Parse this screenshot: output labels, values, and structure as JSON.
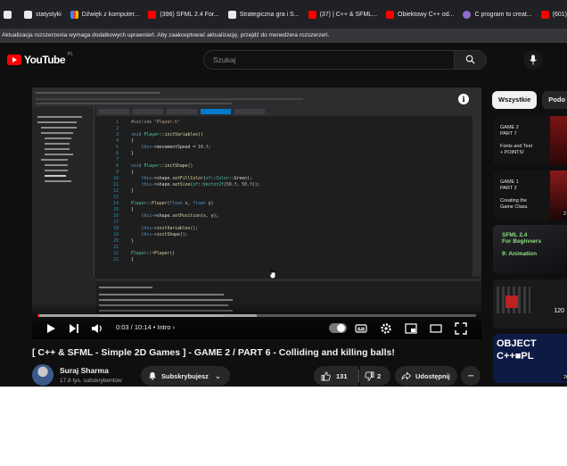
{
  "bookmarks": [
    {
      "label": "",
      "icon": "document-icon"
    },
    {
      "label": "statystyki",
      "icon": "document-icon"
    },
    {
      "label": "Dźwięk z komputer...",
      "icon": "pbr-icon"
    },
    {
      "label": "(396) SFML 2.4 For...",
      "icon": "youtube-icon"
    },
    {
      "label": "Strategiczna gra i S...",
      "icon": "document-icon"
    },
    {
      "label": "(37) | C++ & SFML...",
      "icon": "youtube-icon"
    },
    {
      "label": "Obiektowy C++ od...",
      "icon": "youtube-icon"
    },
    {
      "label": "C program to creat...",
      "icon": "c-icon"
    },
    {
      "label": "(601) Lofi Hip",
      "icon": "youtube-icon"
    }
  ],
  "infobar": {
    "text": "Aktualizacja rozszerzenia wymaga dodatkowych uprawnień. Aby zaakceptować aktualizację, przejdź do menedżera rozszerzeń."
  },
  "header": {
    "logo_text": "YouTube",
    "logo_country": "PL",
    "search_placeholder": "Szukaj"
  },
  "player": {
    "timecode": "0:03 / 10:14",
    "chapter": "• Intro",
    "progress_played": 0.005,
    "progress_loaded": 0.5,
    "code_lines": [
      {
        "n": "1",
        "parts": [
          {
            "c": "pp",
            "t": "#include "
          },
          {
            "c": "st",
            "t": "\"Player.h\""
          }
        ]
      },
      {
        "n": "2",
        "parts": []
      },
      {
        "n": "3",
        "parts": [
          {
            "c": "kw",
            "t": "void "
          },
          {
            "c": "ty",
            "t": "Player"
          },
          {
            "c": "",
            "t": "::"
          },
          {
            "c": "fn",
            "t": "initVariables"
          },
          {
            "c": "",
            "t": "()"
          }
        ]
      },
      {
        "n": "4",
        "parts": [
          {
            "c": "",
            "t": "{"
          }
        ]
      },
      {
        "n": "5",
        "parts": [
          {
            "c": "",
            "t": "    "
          },
          {
            "c": "kw",
            "t": "this"
          },
          {
            "c": "",
            "t": "->movementSpeed = "
          },
          {
            "c": "nu",
            "t": "10.f"
          },
          {
            "c": "",
            "t": ";"
          }
        ]
      },
      {
        "n": "6",
        "parts": [
          {
            "c": "",
            "t": "}"
          }
        ]
      },
      {
        "n": "7",
        "parts": []
      },
      {
        "n": "8",
        "parts": [
          {
            "c": "kw",
            "t": "void "
          },
          {
            "c": "ty",
            "t": "Player"
          },
          {
            "c": "",
            "t": "::"
          },
          {
            "c": "fn",
            "t": "initShape"
          },
          {
            "c": "",
            "t": "()"
          }
        ]
      },
      {
        "n": "9",
        "parts": [
          {
            "c": "",
            "t": "{"
          }
        ]
      },
      {
        "n": "10",
        "parts": [
          {
            "c": "",
            "t": "    "
          },
          {
            "c": "kw",
            "t": "this"
          },
          {
            "c": "",
            "t": "->shape."
          },
          {
            "c": "fn",
            "t": "setFillColor"
          },
          {
            "c": "",
            "t": "("
          },
          {
            "c": "ty",
            "t": "sf"
          },
          {
            "c": "",
            "t": "::"
          },
          {
            "c": "ty",
            "t": "Color"
          },
          {
            "c": "",
            "t": "::Green);"
          }
        ]
      },
      {
        "n": "11",
        "parts": [
          {
            "c": "",
            "t": "    "
          },
          {
            "c": "kw",
            "t": "this"
          },
          {
            "c": "",
            "t": "->shape."
          },
          {
            "c": "fn",
            "t": "setSize"
          },
          {
            "c": "",
            "t": "("
          },
          {
            "c": "ty",
            "t": "sf"
          },
          {
            "c": "",
            "t": "::"
          },
          {
            "c": "ty",
            "t": "Vector2f"
          },
          {
            "c": "",
            "t": "("
          },
          {
            "c": "nu",
            "t": "50.f"
          },
          {
            "c": "",
            "t": ", "
          },
          {
            "c": "nu",
            "t": "50.f"
          },
          {
            "c": "",
            "t": "));"
          }
        ]
      },
      {
        "n": "12",
        "parts": [
          {
            "c": "",
            "t": "}"
          }
        ]
      },
      {
        "n": "13",
        "parts": []
      },
      {
        "n": "14",
        "parts": [
          {
            "c": "ty",
            "t": "Player"
          },
          {
            "c": "",
            "t": "::"
          },
          {
            "c": "fn",
            "t": "Player"
          },
          {
            "c": "",
            "t": "("
          },
          {
            "c": "kw",
            "t": "float "
          },
          {
            "c": "",
            "t": "x, "
          },
          {
            "c": "kw",
            "t": "float "
          },
          {
            "c": "",
            "t": "y)"
          }
        ]
      },
      {
        "n": "15",
        "parts": [
          {
            "c": "",
            "t": "{"
          }
        ]
      },
      {
        "n": "16",
        "parts": [
          {
            "c": "",
            "t": "    "
          },
          {
            "c": "kw",
            "t": "this"
          },
          {
            "c": "",
            "t": "->shape."
          },
          {
            "c": "fn",
            "t": "setPosition"
          },
          {
            "c": "",
            "t": "(x, y);"
          }
        ]
      },
      {
        "n": "17",
        "parts": []
      },
      {
        "n": "18",
        "parts": [
          {
            "c": "",
            "t": "    "
          },
          {
            "c": "kw",
            "t": "this"
          },
          {
            "c": "",
            "t": "->"
          },
          {
            "c": "fn",
            "t": "initVariables"
          },
          {
            "c": "",
            "t": "();"
          }
        ]
      },
      {
        "n": "19",
        "parts": [
          {
            "c": "",
            "t": "    "
          },
          {
            "c": "kw",
            "t": "this"
          },
          {
            "c": "",
            "t": "->"
          },
          {
            "c": "fn",
            "t": "initShape"
          },
          {
            "c": "",
            "t": "();"
          }
        ]
      },
      {
        "n": "20",
        "parts": [
          {
            "c": "",
            "t": "}"
          }
        ]
      },
      {
        "n": "21",
        "parts": []
      },
      {
        "n": "22",
        "parts": [
          {
            "c": "ty",
            "t": "Player"
          },
          {
            "c": "",
            "t": "::~"
          },
          {
            "c": "fn",
            "t": "Player"
          },
          {
            "c": "",
            "t": "()"
          }
        ]
      },
      {
        "n": "23",
        "parts": [
          {
            "c": "",
            "t": "{"
          }
        ]
      }
    ]
  },
  "video": {
    "title": "[ C++ & SFML - Simple 2D Games ] - GAME 2 / PART 6 - Colliding and killing balls!",
    "channel": "Suraj Sharma",
    "subscribers": "17,8 tys. subskrybentów",
    "subscribe_label": "Subskrybujesz",
    "likes": "131",
    "dislikes": "2",
    "share_label": "Udostępnij"
  },
  "sidebar": {
    "chips": [
      "Wszystkie",
      "Podo"
    ],
    "thumbnails": [
      {
        "lines": "GAME 2\nPART 7\n\nFonts and Text\n+ POINTS!",
        "accent": "#c72a2a"
      },
      {
        "lines": "GAME 1\nPART 2\n\nCreating the\nGame Class.",
        "accent": "#c72a2a",
        "duration": "21"
      },
      {
        "lines": "SFML 2.4\nFor Beginners\n\n9: Animation",
        "accent": "#59b548"
      },
      {
        "lines": "",
        "accent": "#b22",
        "duration": "120"
      },
      {
        "lines": "OBJECT\nC++■PL",
        "accent": "#2a4bd8",
        "duration": "26"
      }
    ]
  },
  "colors": {
    "background": "#0f0f0f",
    "accent": "#ff0000",
    "pill": "#272727"
  }
}
